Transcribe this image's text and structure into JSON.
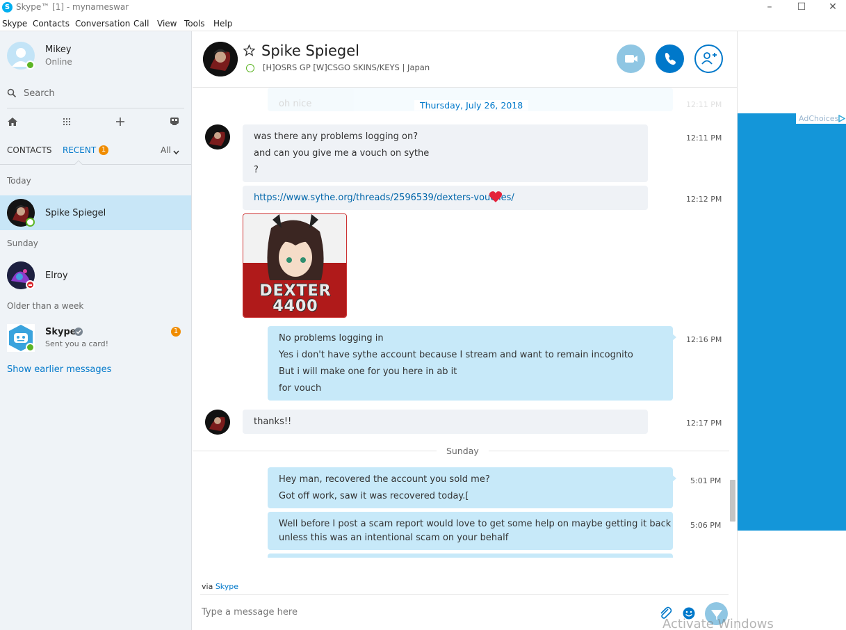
{
  "window": {
    "title": "Skype™ [1] - mynameswar"
  },
  "menu": [
    "Skype",
    "Contacts",
    "Conversation",
    "Call",
    "View",
    "Tools",
    "Help"
  ],
  "profile": {
    "name": "Mikey",
    "status": "Online"
  },
  "search": {
    "label": "Search"
  },
  "tabs": {
    "contacts": "CONTACTS",
    "recent": "RECENT",
    "recent_badge": "1",
    "filter": "All"
  },
  "sections": {
    "today": "Today",
    "sunday": "Sunday",
    "older": "Older than a week"
  },
  "contacts": [
    {
      "name": "Spike Spiegel"
    },
    {
      "name": "Elroy"
    },
    {
      "name": "Skype",
      "subtitle": "Sent you a card!",
      "badge": "1"
    }
  ],
  "show_earlier": "Show earlier messages",
  "chat": {
    "name": "Spike Spiegel",
    "mood": "[H]OSRS GP [W]CSGO SKINS/KEYS",
    "location": "Japan"
  },
  "faded_prev": {
    "text": "oh nice",
    "time": "12:11 PM"
  },
  "date_sep1": "Thursday, July 26, 2018",
  "date_sep2": "Sunday",
  "messages": [
    {
      "lines": [
        "was there any problems logging on?",
        "and can you give me a vouch on sythe",
        "?"
      ],
      "time": "12:11 PM"
    },
    {
      "link": "https://www.sythe.org/threads/2596539/dexters-vouches/",
      "time": "12:12 PM"
    },
    {
      "image_text": [
        "DEXTER",
        "4400"
      ]
    },
    {
      "lines": [
        "No problems logging in",
        "Yes i don't have sythe account because I stream and want to remain incognito",
        "But i will make one for you here in ab it",
        "for vouch"
      ],
      "time": "12:16 PM"
    },
    {
      "lines": [
        "thanks!!"
      ],
      "time": "12:17 PM"
    },
    {
      "lines": [
        "Hey man, recovered the account you sold me?",
        "Got off work, saw it was recovered today.["
      ],
      "time": "5:01 PM"
    },
    {
      "lines": [
        "Well before I post a scam report would love to get some help on maybe getting it back",
        "unless this was an intentional scam on your behalf"
      ],
      "time": "5:06 PM"
    }
  ],
  "compose": {
    "via_prefix": "via",
    "via_link": "Skype",
    "placeholder": "Type a message here"
  },
  "ad": {
    "adchoices": "AdChoices"
  },
  "watermark": "Activate Windows",
  "colors": {
    "skype_blue": "#0078ca",
    "outgoing_bubble": "#c7e9f9",
    "incoming_bubble": "#eff2f6",
    "online_green": "#5db525",
    "ad_blue": "#1496d9"
  }
}
